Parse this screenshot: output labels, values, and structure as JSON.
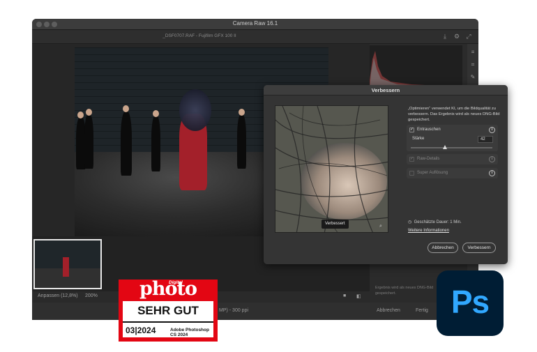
{
  "window": {
    "title": "Camera Raw 16.1",
    "file": "_DSF0707.RAF  -  Fujifilm GFX 100 II"
  },
  "bottombar": {
    "zoom_fit": "Anpassen (12,8%)",
    "zoom_level": "200%"
  },
  "statusbar": {
    "info": "MP) - 300 ppi",
    "cancel": "Abbrechen",
    "done": "Fertig"
  },
  "rightpanel": {
    "text_line1": "Ergebnis wird als neues DNG-Bild",
    "text_line2": "gespeichert.",
    "item": "Manuelle Rauschreduzierung"
  },
  "dialog": {
    "title": "Verbessern",
    "description": "„Optimieren“ verwendet KI, um die Bildqualität zu verbessern. Das Ergebnis wird als neues DNG-Bild gespeichert.",
    "preview_badge": "Verbessert",
    "denoise": {
      "label": "Entrauschen",
      "checked": true,
      "strength_label": "Stärke",
      "strength_value": "42",
      "strength_fraction": 0.42
    },
    "raw_details": {
      "label": "Raw-Details",
      "checked": true,
      "enabled": false
    },
    "super_resolution": {
      "label": "Super Auflösung",
      "checked": false,
      "enabled": false
    },
    "duration": "Geschätzte Dauer: 1 Min.",
    "more_info": "Weitere Informationen",
    "cancel_button": "Abbrechen",
    "confirm_button": "Verbessern"
  },
  "award": {
    "brand": "photo",
    "brand_prefix": "Digital",
    "grade": "SEHR GUT",
    "issue": "03|2024",
    "product": "Adobe Photoshop CS 2024"
  },
  "ps_logo": {
    "text": "Ps"
  },
  "colors": {
    "award_red": "#e30613",
    "ps_bg": "#001d34",
    "ps_fg": "#31a8ff"
  }
}
